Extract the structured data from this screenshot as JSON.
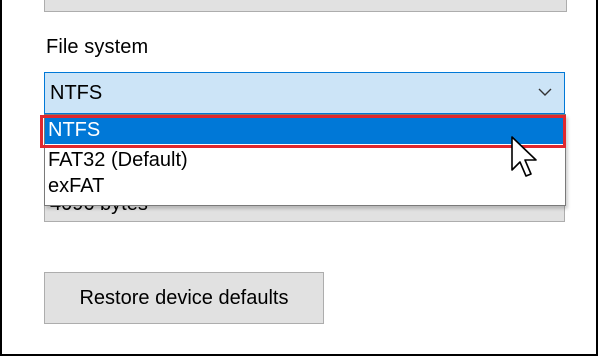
{
  "file_system": {
    "label": "File system",
    "selected_value": "NTFS",
    "options": [
      "NTFS",
      "FAT32 (Default)",
      "exFAT"
    ],
    "highlighted_option": "NTFS"
  },
  "allocation_unit": {
    "value_partial": "4096 bytes"
  },
  "buttons": {
    "restore_defaults": "Restore device defaults"
  },
  "icons": {
    "chevron": "chevron-down-icon",
    "cursor": "mouse-pointer-icon"
  },
  "colors": {
    "selection_bg": "#0078d7",
    "combo_bg": "#cce4f7",
    "highlight_border": "#e0282e",
    "button_bg": "#e1e1e1"
  }
}
